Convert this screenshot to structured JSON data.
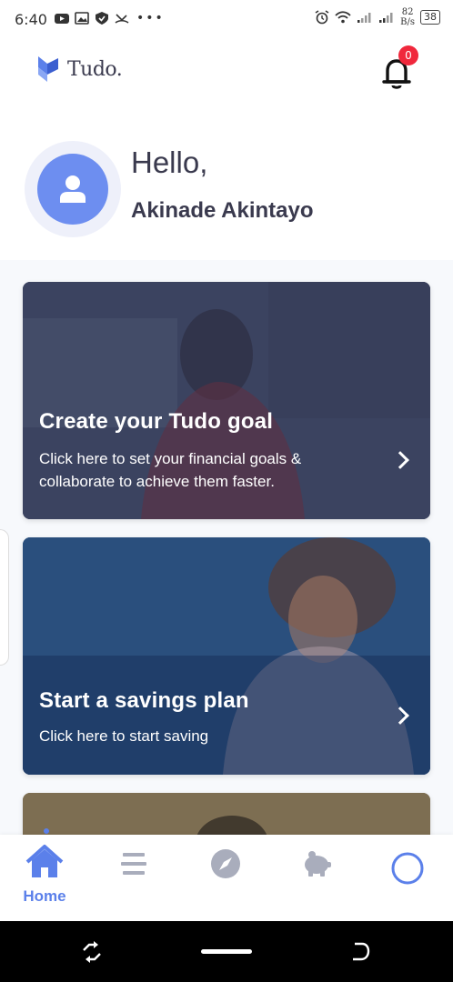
{
  "status_bar": {
    "time": "6:40",
    "speed_value": "82",
    "speed_unit": "B/s",
    "battery": "38"
  },
  "header": {
    "logo_text": "Tudo.",
    "notification_count": "0"
  },
  "greeting": {
    "hello": "Hello,",
    "user_name": "Akinade Akintayo"
  },
  "cards": [
    {
      "title": "Create your Tudo goal",
      "description": "Click here to set your financial goals & collaborate to achieve them faster."
    },
    {
      "title": "Start a savings plan",
      "description": "Click here to start saving"
    }
  ],
  "bottom_nav": {
    "items": [
      {
        "icon": "home-icon",
        "label": "Home",
        "active": true
      },
      {
        "icon": "list-icon",
        "label": "",
        "active": false
      },
      {
        "icon": "compass-icon",
        "label": "",
        "active": false
      },
      {
        "icon": "piggy-bank-icon",
        "label": "",
        "active": false
      },
      {
        "icon": "profile-circle-icon",
        "label": "",
        "active": false
      }
    ]
  },
  "colors": {
    "accent": "#5b80ea",
    "avatar": "#6d8ef0",
    "badge": "#f0283c",
    "inactive_icon": "#a9adbc"
  }
}
